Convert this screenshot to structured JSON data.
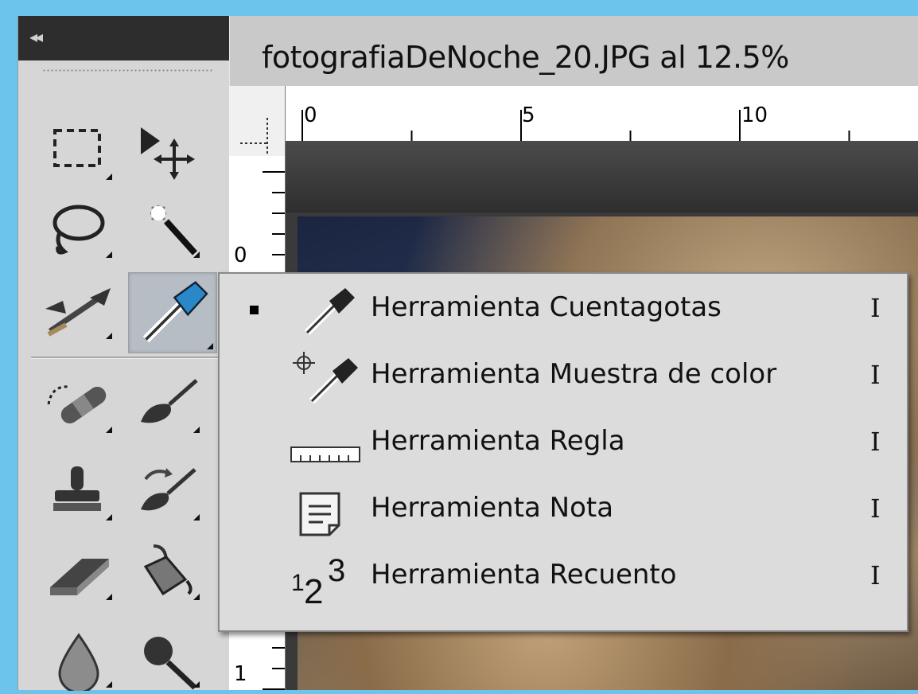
{
  "toolbox": {
    "collapse_glyph": "◂◂",
    "tools": [
      {
        "name": "rectangular-marquee",
        "icon": "marquee-icon"
      },
      {
        "name": "move",
        "icon": "move-icon"
      },
      {
        "name": "lasso",
        "icon": "lasso-icon"
      },
      {
        "name": "magic-wand",
        "icon": "magic-wand-icon"
      },
      {
        "name": "crop",
        "icon": "crop-icon"
      },
      {
        "name": "eyedropper",
        "icon": "eyedropper-icon",
        "selected": true
      },
      {
        "name": "spot-healing",
        "icon": "bandage-icon"
      },
      {
        "name": "brush",
        "icon": "brush-icon"
      },
      {
        "name": "clone-stamp",
        "icon": "stamp-icon"
      },
      {
        "name": "history-brush",
        "icon": "history-brush-icon"
      },
      {
        "name": "eraser",
        "icon": "eraser-icon"
      },
      {
        "name": "paint-bucket",
        "icon": "bucket-icon"
      },
      {
        "name": "blur",
        "icon": "drop-icon"
      },
      {
        "name": "dodge",
        "icon": "dodge-icon"
      }
    ]
  },
  "document": {
    "title": "fotografiaDeNoche_20.JPG al 12.5%",
    "ruler_top_labels": [
      "0",
      "5",
      "10"
    ],
    "ruler_left_labels": [
      "0",
      "1"
    ]
  },
  "flyout": {
    "items": [
      {
        "label": "Herramienta Cuentagotas",
        "shortcut": "I",
        "icon": "eyedropper-icon",
        "active": true
      },
      {
        "label": "Herramienta Muestra de color",
        "shortcut": "I",
        "icon": "color-sampler-icon",
        "active": false
      },
      {
        "label": "Herramienta Regla",
        "shortcut": "I",
        "icon": "ruler-icon",
        "active": false
      },
      {
        "label": "Herramienta Nota",
        "shortcut": "I",
        "icon": "note-icon",
        "active": false
      },
      {
        "label": "Herramienta Recuento",
        "shortcut": "I",
        "icon": "count-icon",
        "active": false
      }
    ],
    "count_icon_glyphs": {
      "one": "1",
      "two": "2",
      "three": "3"
    }
  },
  "colors": {
    "background": "#6cc3ec",
    "panel": "#d6d6d6",
    "panel_header": "#2d2d2d",
    "menu": "#dcdcdc",
    "eyedropper_accent": "#2a87c8"
  }
}
